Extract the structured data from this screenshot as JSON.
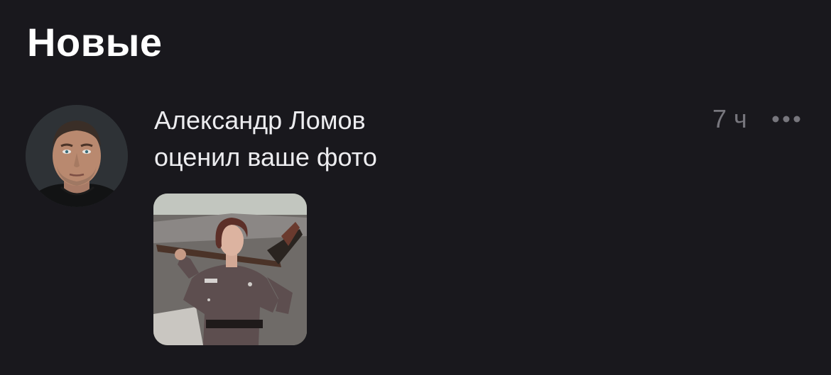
{
  "section": {
    "title": "Новые"
  },
  "notification": {
    "author_name": "Александр Ломов",
    "action_text": "оценил ваше фото",
    "time": "7 ч",
    "more_icon": "more-horizontal-icon",
    "avatar_icon": "user-avatar",
    "photo_icon": "liked-photo-thumbnail"
  },
  "colors": {
    "background": "#19181d",
    "primary_text": "#ececef",
    "secondary_text": "#77767d"
  }
}
